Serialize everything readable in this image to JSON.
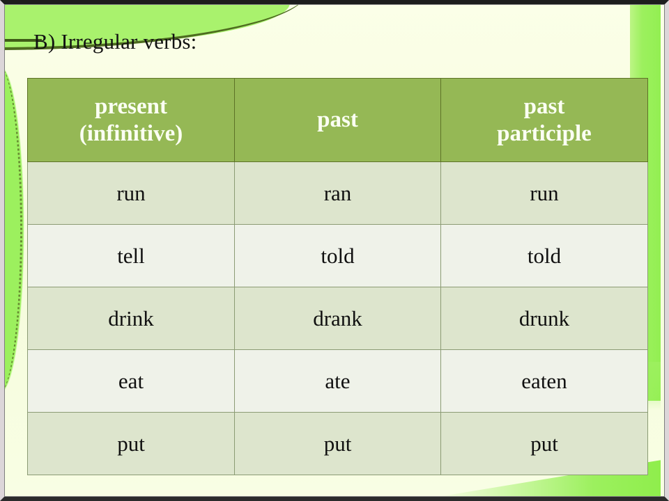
{
  "slide": {
    "title": "B) Irregular verbs:"
  },
  "table": {
    "headers": [
      "present\n(infinitive)",
      "past",
      "past\nparticiple"
    ],
    "header_lines": [
      [
        "present",
        "(infinitive)"
      ],
      [
        "past"
      ],
      [
        "past",
        "participle"
      ]
    ],
    "rows": [
      [
        "run",
        "ran",
        "run"
      ],
      [
        "tell",
        "told",
        "told"
      ],
      [
        "drink",
        "drank",
        "drunk"
      ],
      [
        "eat",
        "ate",
        "eaten"
      ],
      [
        "put",
        "put",
        "put"
      ]
    ]
  },
  "colors": {
    "background": "#f7fde0",
    "header_green": "#95b855",
    "row_odd": "#dde5cd",
    "row_even": "#eff2e9",
    "accent_bright_green": "#9cf05e",
    "header_text": "#fbfff3",
    "body_text": "#101010",
    "border_dark": "#5d7227",
    "frame": "#2b2b2b"
  }
}
